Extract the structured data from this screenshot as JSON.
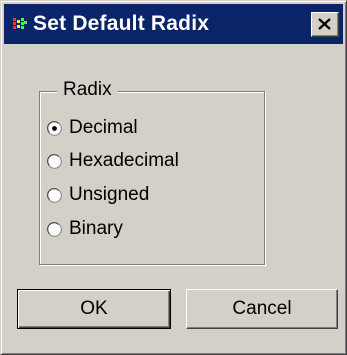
{
  "window": {
    "title": "Set Default Radix",
    "icon": "app-icon"
  },
  "radix_group": {
    "label": "Radix",
    "selected": "Decimal",
    "options": [
      {
        "label": "Decimal",
        "checked": true
      },
      {
        "label": "Hexadecimal",
        "checked": false
      },
      {
        "label": "Unsigned",
        "checked": false
      },
      {
        "label": "Binary",
        "checked": false
      }
    ]
  },
  "buttons": {
    "ok_label": "OK",
    "cancel_label": "Cancel"
  },
  "colors": {
    "titlebar": "#0a246a",
    "face": "#d4d0c8"
  }
}
